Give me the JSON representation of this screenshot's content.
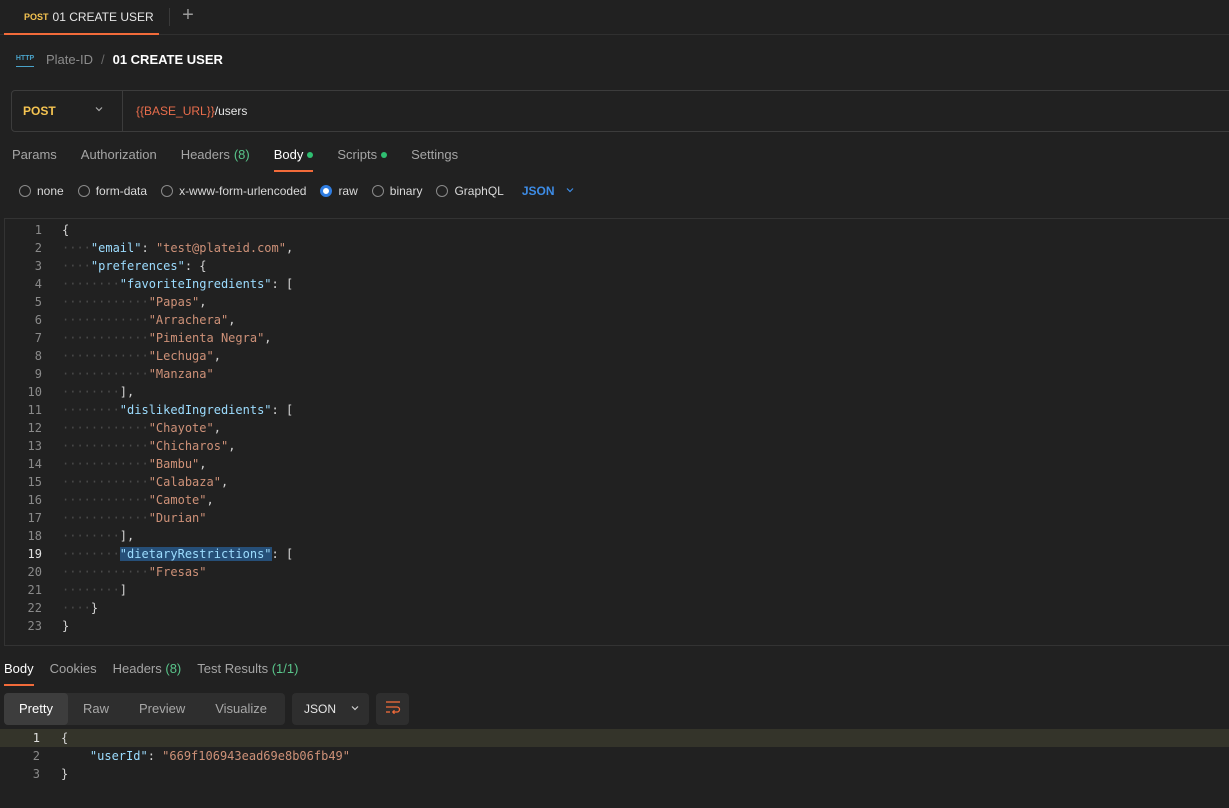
{
  "tab": {
    "method": "POST",
    "name": "01 CREATE USER",
    "new_tab_icon": "+"
  },
  "breadcrumb": {
    "icon_label": "HTTP",
    "parent": "Plate-ID",
    "separator": "/",
    "current": "01 CREATE USER"
  },
  "request": {
    "method": "POST",
    "url_variable": "{{BASE_URL}}",
    "url_path": "/users"
  },
  "request_tabs": [
    {
      "label": "Params"
    },
    {
      "label": "Authorization"
    },
    {
      "label": "Headers",
      "count": "(8)"
    },
    {
      "label": "Body",
      "dot": true,
      "active": true
    },
    {
      "label": "Scripts",
      "dot": true
    },
    {
      "label": "Settings"
    }
  ],
  "body_types": {
    "options": [
      "none",
      "form-data",
      "x-www-form-urlencoded",
      "raw",
      "binary",
      "GraphQL"
    ],
    "selected": "raw",
    "format": "JSON"
  },
  "request_body": {
    "email": "test@plateid.com",
    "favoriteIngredients": [
      "Papas",
      "Arrachera",
      "Pimienta Negra",
      "Lechuga",
      "Manzana"
    ],
    "dislikedIngredients": [
      "Chayote",
      "Chicharos",
      "Bambu",
      "Calabaza",
      "Camote",
      "Durian"
    ],
    "dietaryRestrictions": [
      "Fresas"
    ],
    "line_count": 23,
    "highlighted_key": "dietaryRestrictions"
  },
  "response_tabs": [
    {
      "label": "Body",
      "active": true
    },
    {
      "label": "Cookies"
    },
    {
      "label": "Headers",
      "count": "(8)"
    },
    {
      "label": "Test Results",
      "count": "(1/1)"
    }
  ],
  "response_views": [
    "Pretty",
    "Raw",
    "Preview",
    "Visualize"
  ],
  "response_format": "JSON",
  "response_body": {
    "userId": "669f106943ead69e8b06fb49"
  },
  "colors": {
    "accent": "#f26b3a",
    "method": "#f5c451",
    "key": "#9cdcfe",
    "string": "#ce9178",
    "count": "#59c48a"
  }
}
